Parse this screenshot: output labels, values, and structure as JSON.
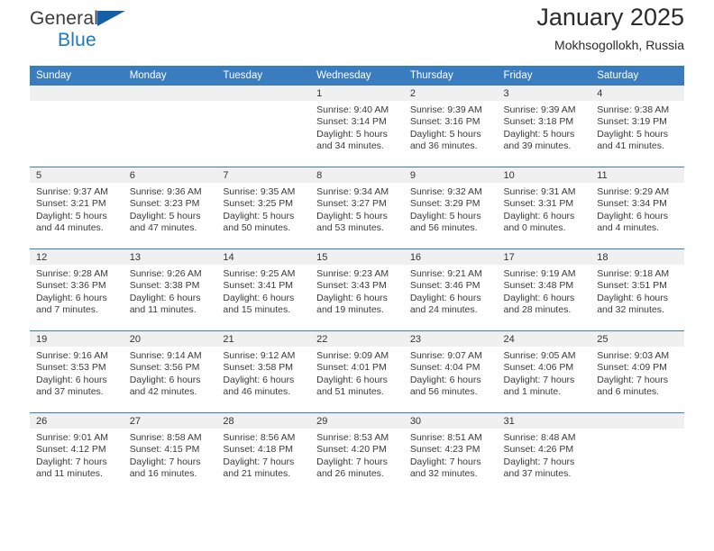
{
  "brand": {
    "name_top": "General",
    "name_bottom": "Blue",
    "accent_color": "#1a7ac4",
    "flag_color": "#1261a8"
  },
  "header": {
    "title": "January 2025",
    "subtitle": "Mokhsogollokh, Russia"
  },
  "calendar": {
    "header_color": "#3a7cc0",
    "daynum_band_color": "#f0f0f0",
    "weekday_headers": [
      "Sunday",
      "Monday",
      "Tuesday",
      "Wednesday",
      "Thursday",
      "Friday",
      "Saturday"
    ],
    "weeks": [
      [
        {
          "day": "",
          "lines": []
        },
        {
          "day": "",
          "lines": []
        },
        {
          "day": "",
          "lines": []
        },
        {
          "day": "1",
          "lines": [
            "Sunrise: 9:40 AM",
            "Sunset: 3:14 PM",
            "Daylight: 5 hours",
            "and 34 minutes."
          ]
        },
        {
          "day": "2",
          "lines": [
            "Sunrise: 9:39 AM",
            "Sunset: 3:16 PM",
            "Daylight: 5 hours",
            "and 36 minutes."
          ]
        },
        {
          "day": "3",
          "lines": [
            "Sunrise: 9:39 AM",
            "Sunset: 3:18 PM",
            "Daylight: 5 hours",
            "and 39 minutes."
          ]
        },
        {
          "day": "4",
          "lines": [
            "Sunrise: 9:38 AM",
            "Sunset: 3:19 PM",
            "Daylight: 5 hours",
            "and 41 minutes."
          ]
        }
      ],
      [
        {
          "day": "5",
          "lines": [
            "Sunrise: 9:37 AM",
            "Sunset: 3:21 PM",
            "Daylight: 5 hours",
            "and 44 minutes."
          ]
        },
        {
          "day": "6",
          "lines": [
            "Sunrise: 9:36 AM",
            "Sunset: 3:23 PM",
            "Daylight: 5 hours",
            "and 47 minutes."
          ]
        },
        {
          "day": "7",
          "lines": [
            "Sunrise: 9:35 AM",
            "Sunset: 3:25 PM",
            "Daylight: 5 hours",
            "and 50 minutes."
          ]
        },
        {
          "day": "8",
          "lines": [
            "Sunrise: 9:34 AM",
            "Sunset: 3:27 PM",
            "Daylight: 5 hours",
            "and 53 minutes."
          ]
        },
        {
          "day": "9",
          "lines": [
            "Sunrise: 9:32 AM",
            "Sunset: 3:29 PM",
            "Daylight: 5 hours",
            "and 56 minutes."
          ]
        },
        {
          "day": "10",
          "lines": [
            "Sunrise: 9:31 AM",
            "Sunset: 3:31 PM",
            "Daylight: 6 hours",
            "and 0 minutes."
          ]
        },
        {
          "day": "11",
          "lines": [
            "Sunrise: 9:29 AM",
            "Sunset: 3:34 PM",
            "Daylight: 6 hours",
            "and 4 minutes."
          ]
        }
      ],
      [
        {
          "day": "12",
          "lines": [
            "Sunrise: 9:28 AM",
            "Sunset: 3:36 PM",
            "Daylight: 6 hours",
            "and 7 minutes."
          ]
        },
        {
          "day": "13",
          "lines": [
            "Sunrise: 9:26 AM",
            "Sunset: 3:38 PM",
            "Daylight: 6 hours",
            "and 11 minutes."
          ]
        },
        {
          "day": "14",
          "lines": [
            "Sunrise: 9:25 AM",
            "Sunset: 3:41 PM",
            "Daylight: 6 hours",
            "and 15 minutes."
          ]
        },
        {
          "day": "15",
          "lines": [
            "Sunrise: 9:23 AM",
            "Sunset: 3:43 PM",
            "Daylight: 6 hours",
            "and 19 minutes."
          ]
        },
        {
          "day": "16",
          "lines": [
            "Sunrise: 9:21 AM",
            "Sunset: 3:46 PM",
            "Daylight: 6 hours",
            "and 24 minutes."
          ]
        },
        {
          "day": "17",
          "lines": [
            "Sunrise: 9:19 AM",
            "Sunset: 3:48 PM",
            "Daylight: 6 hours",
            "and 28 minutes."
          ]
        },
        {
          "day": "18",
          "lines": [
            "Sunrise: 9:18 AM",
            "Sunset: 3:51 PM",
            "Daylight: 6 hours",
            "and 32 minutes."
          ]
        }
      ],
      [
        {
          "day": "19",
          "lines": [
            "Sunrise: 9:16 AM",
            "Sunset: 3:53 PM",
            "Daylight: 6 hours",
            "and 37 minutes."
          ]
        },
        {
          "day": "20",
          "lines": [
            "Sunrise: 9:14 AM",
            "Sunset: 3:56 PM",
            "Daylight: 6 hours",
            "and 42 minutes."
          ]
        },
        {
          "day": "21",
          "lines": [
            "Sunrise: 9:12 AM",
            "Sunset: 3:58 PM",
            "Daylight: 6 hours",
            "and 46 minutes."
          ]
        },
        {
          "day": "22",
          "lines": [
            "Sunrise: 9:09 AM",
            "Sunset: 4:01 PM",
            "Daylight: 6 hours",
            "and 51 minutes."
          ]
        },
        {
          "day": "23",
          "lines": [
            "Sunrise: 9:07 AM",
            "Sunset: 4:04 PM",
            "Daylight: 6 hours",
            "and 56 minutes."
          ]
        },
        {
          "day": "24",
          "lines": [
            "Sunrise: 9:05 AM",
            "Sunset: 4:06 PM",
            "Daylight: 7 hours",
            "and 1 minute."
          ]
        },
        {
          "day": "25",
          "lines": [
            "Sunrise: 9:03 AM",
            "Sunset: 4:09 PM",
            "Daylight: 7 hours",
            "and 6 minutes."
          ]
        }
      ],
      [
        {
          "day": "26",
          "lines": [
            "Sunrise: 9:01 AM",
            "Sunset: 4:12 PM",
            "Daylight: 7 hours",
            "and 11 minutes."
          ]
        },
        {
          "day": "27",
          "lines": [
            "Sunrise: 8:58 AM",
            "Sunset: 4:15 PM",
            "Daylight: 7 hours",
            "and 16 minutes."
          ]
        },
        {
          "day": "28",
          "lines": [
            "Sunrise: 8:56 AM",
            "Sunset: 4:18 PM",
            "Daylight: 7 hours",
            "and 21 minutes."
          ]
        },
        {
          "day": "29",
          "lines": [
            "Sunrise: 8:53 AM",
            "Sunset: 4:20 PM",
            "Daylight: 7 hours",
            "and 26 minutes."
          ]
        },
        {
          "day": "30",
          "lines": [
            "Sunrise: 8:51 AM",
            "Sunset: 4:23 PM",
            "Daylight: 7 hours",
            "and 32 minutes."
          ]
        },
        {
          "day": "31",
          "lines": [
            "Sunrise: 8:48 AM",
            "Sunset: 4:26 PM",
            "Daylight: 7 hours",
            "and 37 minutes."
          ]
        },
        {
          "day": "",
          "lines": []
        }
      ]
    ]
  }
}
